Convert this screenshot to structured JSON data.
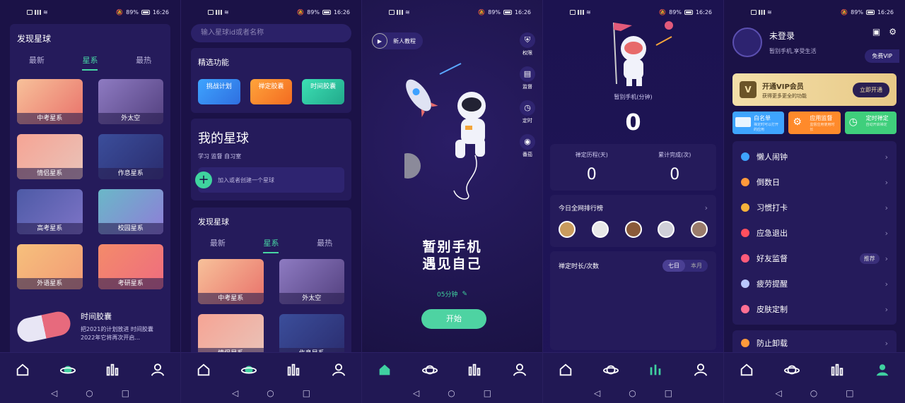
{
  "status": {
    "battery": "89%",
    "time": "16:26"
  },
  "screen1": {
    "title": "发现星球",
    "tabs": [
      "最新",
      "星系",
      "最热"
    ],
    "active_tab": 1,
    "tiles": [
      "中考星系",
      "外太空",
      "情侣星系",
      "作息星系",
      "高考星系",
      "校园星系",
      "外语星系",
      "考研星系"
    ],
    "capsule": {
      "title": "时间胶囊",
      "line1": "把2021的计划放进 时间胶囊",
      "line2": "2022年它将再次开启..."
    }
  },
  "screen2": {
    "search_placeholder": "输入星球id或者名称",
    "featured_title": "精选功能",
    "featured": [
      "挑战计划",
      "禅定胶囊",
      "时间胶囊"
    ],
    "my_planet_title": "我的星球",
    "my_planet_tags": "学习 监督 自习室",
    "add_planet": "加入或者创建一个星球",
    "discover_title": "发现星球",
    "tabs": [
      "最新",
      "星系",
      "最热"
    ],
    "active_tab": 1,
    "tiles": [
      "中考星系",
      "外太空",
      "情侣星系",
      "作息星系"
    ]
  },
  "screen3": {
    "tutorial": "新人教程",
    "side_buttons": [
      "权限",
      "监督",
      "定时",
      "番茄"
    ],
    "slogan_line1": "暂别手机",
    "slogan_line2": "遇见自己",
    "duration": "05分钟",
    "start": "开始"
  },
  "screen4": {
    "label": "暂别手机(分钟)",
    "minutes": "0",
    "stat1_label": "禅定历程(天)",
    "stat1_value": "0",
    "stat2_label": "累计完成(次)",
    "stat2_value": "0",
    "ranking_title": "今日全网排行榜",
    "duration_title": "禅定时长/次数",
    "seg_week": "七日",
    "seg_month": "本月"
  },
  "screen5": {
    "username": "未登录",
    "subtitle": "暂别手机,享受生活",
    "free_vip": "免费VIP",
    "vip_title": "开通VIP会员",
    "vip_sub": "获得更多更全的功能",
    "vip_button": "立即开通",
    "quick": [
      {
        "title": "白名单",
        "sub": "禅定时可以打开的应用"
      },
      {
        "title": "应用监督",
        "sub": "监督应用使用时长"
      },
      {
        "title": "定时禅定",
        "sub": "自动开启禅定"
      }
    ],
    "menu": [
      "懒人闹钟",
      "倒数日",
      "习惯打卡",
      "应急退出",
      "好友监督",
      "疲劳提醒",
      "皮肤定制"
    ],
    "recommend_badge": "推荐",
    "last_item": "防止卸载"
  },
  "colors": {
    "bg": "#1b1247",
    "card": "#251b5b",
    "accent": "#47d6a4",
    "gold": "#f0d79a"
  }
}
